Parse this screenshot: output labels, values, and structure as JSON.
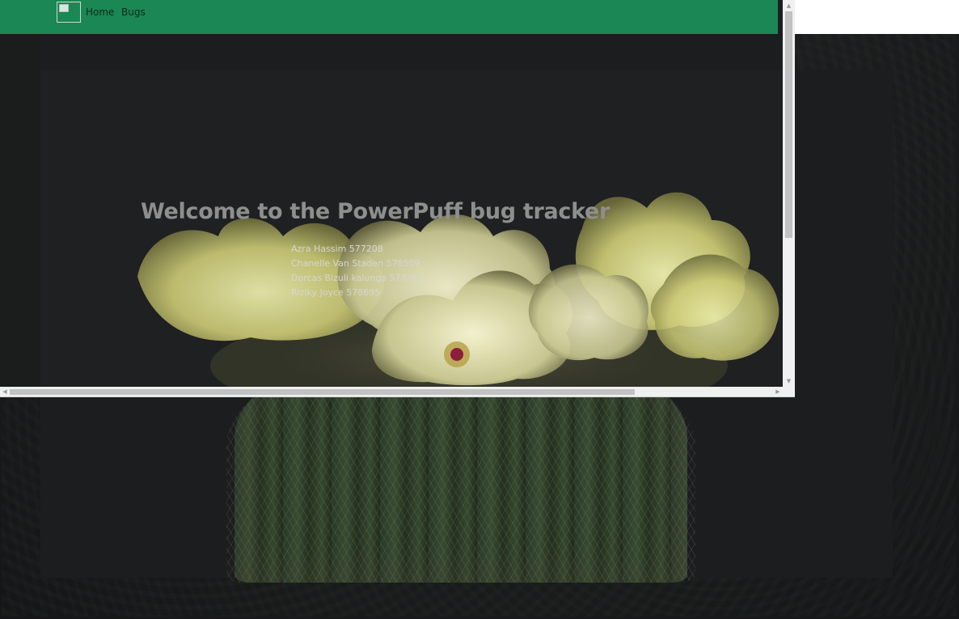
{
  "navbar": {
    "logo_icon": "broken-image-icon",
    "links": [
      {
        "label": "Home"
      },
      {
        "label": "Bugs"
      }
    ],
    "color": "#1b8754"
  },
  "hero": {
    "title": "Welcome to the PowerPuff bug tracker",
    "team": [
      "Azra Hassim 577208",
      "Chanelle Van Staden 578509",
      "Dorcas Bizuli kalunga 578240",
      "Riziky Joyce 578695"
    ]
  },
  "background": {
    "image": "yellow-flowering-cactus",
    "overlay_color": "#1c1d1f"
  },
  "scrollbars": {
    "vertical_icon_up": "arrow-up-icon",
    "vertical_icon_down": "arrow-down-icon",
    "horizontal_icon_left": "arrow-left-icon",
    "horizontal_icon_right": "arrow-right-icon"
  }
}
